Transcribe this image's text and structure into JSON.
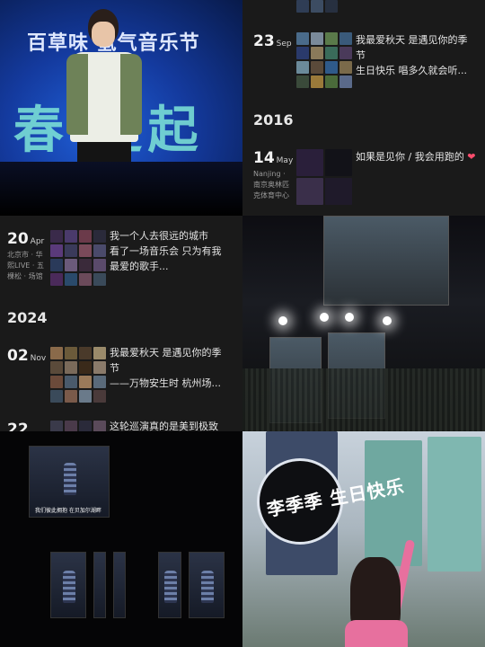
{
  "photo1": {
    "logo": "百草味 氢气音乐节",
    "big_text": "春 走起"
  },
  "timeline_top": {
    "entries": [
      {
        "day": "23",
        "month": "Sep",
        "text_line1": "我最爱秋天  是遇见你的季",
        "text_line2": "节",
        "text_line3": "生日快乐  唱多久就会听..."
      }
    ],
    "year": "2016",
    "entry2": {
      "day": "14",
      "month": "May",
      "loc_line1": "Nanjing ·",
      "loc_line2": "南京奥林匹",
      "loc_line3": "克体育中心",
      "text": "如果是见你 / 我会用跑的",
      "heart": "❤"
    }
  },
  "timeline_mid": {
    "entry1": {
      "day": "20",
      "month": "Apr",
      "loc_line1": "北京市 · 华",
      "loc_line2": "熙LIVE · 五",
      "loc_line3": "棵松 · 场馆",
      "text_line1": "我一个人去很远的城市",
      "text_line2": "看了一场音乐会 只为有我",
      "text_line3": "最爱的歌手..."
    },
    "year": "2024",
    "entry2": {
      "day": "02",
      "month": "Nov",
      "text_line1": "我最爱秋天 是遇见你的季",
      "text_line2": "节",
      "text_line3": "——万物安生时 杭州场..."
    },
    "entry3": {
      "day": "22",
      "month": "",
      "text_line1": "这轮巡演真的是美到极致"
    }
  },
  "photo5": {
    "subtitle": "我们彼此拥抱 在贝加尔湖畔"
  },
  "photo6": {
    "sign": "李季季 生日快乐"
  },
  "colors": {
    "thumb_palette": [
      "#3a4a6b",
      "#6b4a3a",
      "#2f5a4a",
      "#5a3a6b",
      "#8a6a3a",
      "#3a6b8a",
      "#6b6b3a",
      "#4a2f3a",
      "#2a3a5a"
    ]
  }
}
